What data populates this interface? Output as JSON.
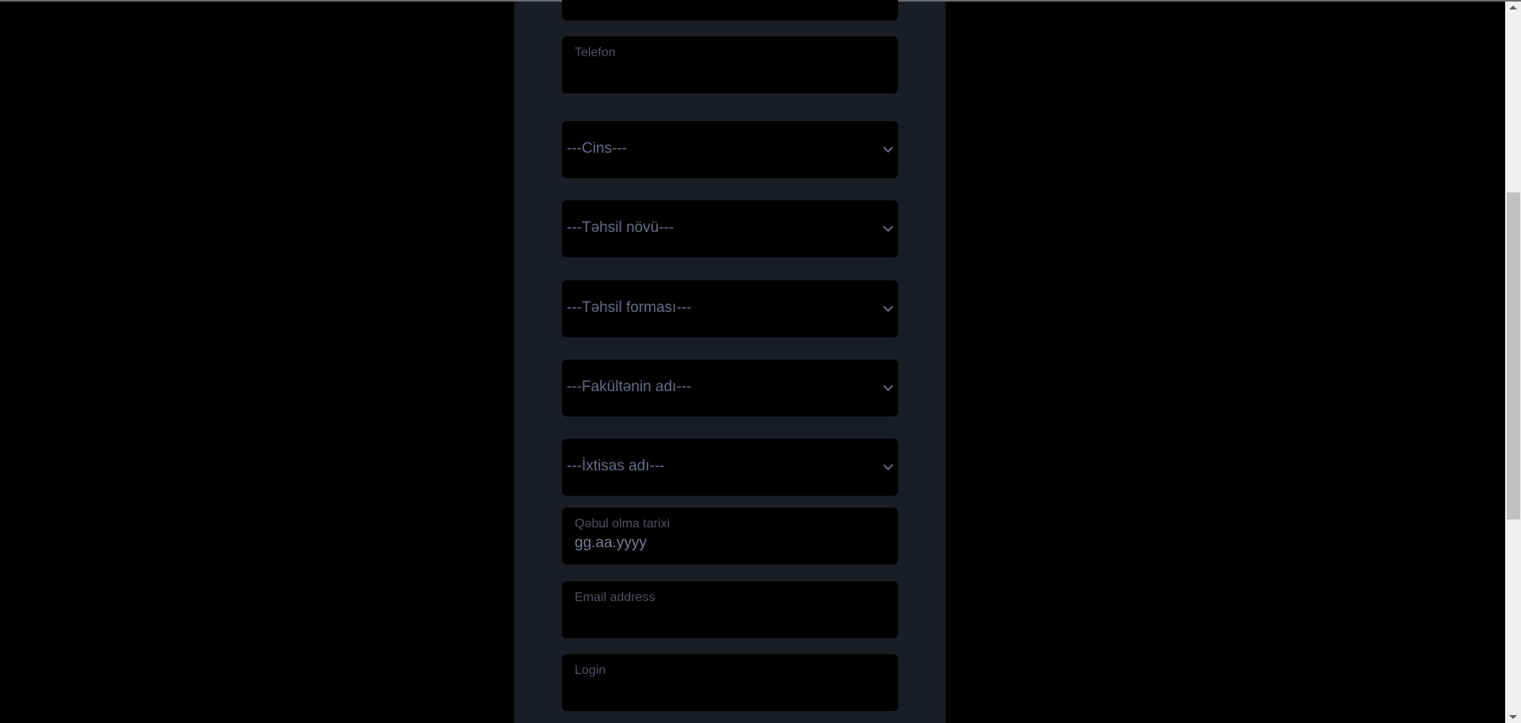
{
  "form": {
    "telefon_label": "Telefon",
    "gender_select": "---Cins---",
    "education_type_select": "---Təhsil növü---",
    "education_form_select": "---Təhsil forması---",
    "faculty_select": "---Fakültənin adı---",
    "specialty_select": "---İxtisas adı---",
    "admission_date_label": "Qəbul olma tarixi",
    "admission_date_value": "gg.aa.yyyy",
    "email_label": "Email address",
    "login_label": "Login"
  },
  "icons": {
    "select_arrow": "chevron-down-icon"
  },
  "colors": {
    "background": "#000000",
    "panel": "#1b1d26",
    "field": "#000000",
    "text": "#676b86"
  }
}
